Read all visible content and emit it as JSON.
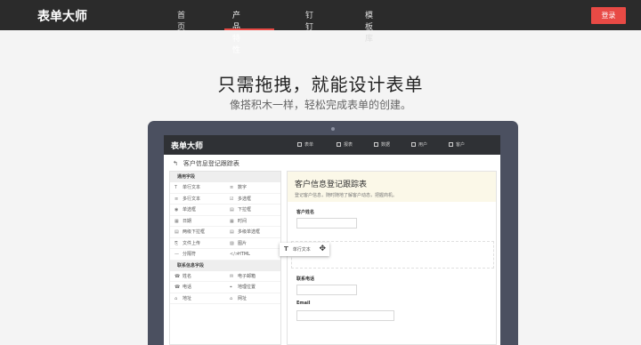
{
  "brand": "表单大师",
  "nav": {
    "items": [
      "首页",
      "产品特性",
      "钉钉",
      "模板库"
    ],
    "active": "产品特性",
    "login": "登录"
  },
  "hero": {
    "title": "只需拖拽，就能设计表单",
    "subtitle": "像搭积木一样，轻松完成表单的创建。"
  },
  "app": {
    "logo": "表单大师",
    "nav": [
      "表单",
      "报表",
      "数据",
      "用户",
      "客户"
    ],
    "breadcrumb": "客户信息登记跟踪表",
    "palette": {
      "section1": "通用字段",
      "items1": [
        [
          "T",
          "单行文本"
        ],
        [
          "≡",
          "数字"
        ],
        [
          "≡",
          "多行文本"
        ],
        [
          "☑",
          "多选框"
        ],
        [
          "◉",
          "单选框"
        ],
        [
          "▤",
          "下拉框"
        ],
        [
          "▦",
          "日期"
        ],
        [
          "▦",
          "时间"
        ],
        [
          "▤",
          "两级下拉框"
        ],
        [
          "▤",
          "多级单选框"
        ],
        [
          "⎘",
          "文件上传"
        ],
        [
          "▨",
          "图片"
        ],
        [
          "—",
          "分隔符"
        ],
        [
          "</>",
          "HTML"
        ]
      ],
      "section2": "联系信息字段",
      "items2": [
        [
          "☎",
          "姓名"
        ],
        [
          "✉",
          "电子邮箱"
        ],
        [
          "☎",
          "电话"
        ],
        [
          "⌖",
          "地理位置"
        ],
        [
          "⌂",
          "地址"
        ],
        [
          "⌂",
          "网址"
        ]
      ]
    },
    "form": {
      "title": "客户信息登记跟踪表",
      "description": "登记客户信息，随时随地了解客户动态，把握商机。",
      "fields": [
        "客户姓名",
        "联系电话",
        "Email"
      ],
      "drag_chip": "单行文本",
      "drag_glyph": "T"
    }
  }
}
